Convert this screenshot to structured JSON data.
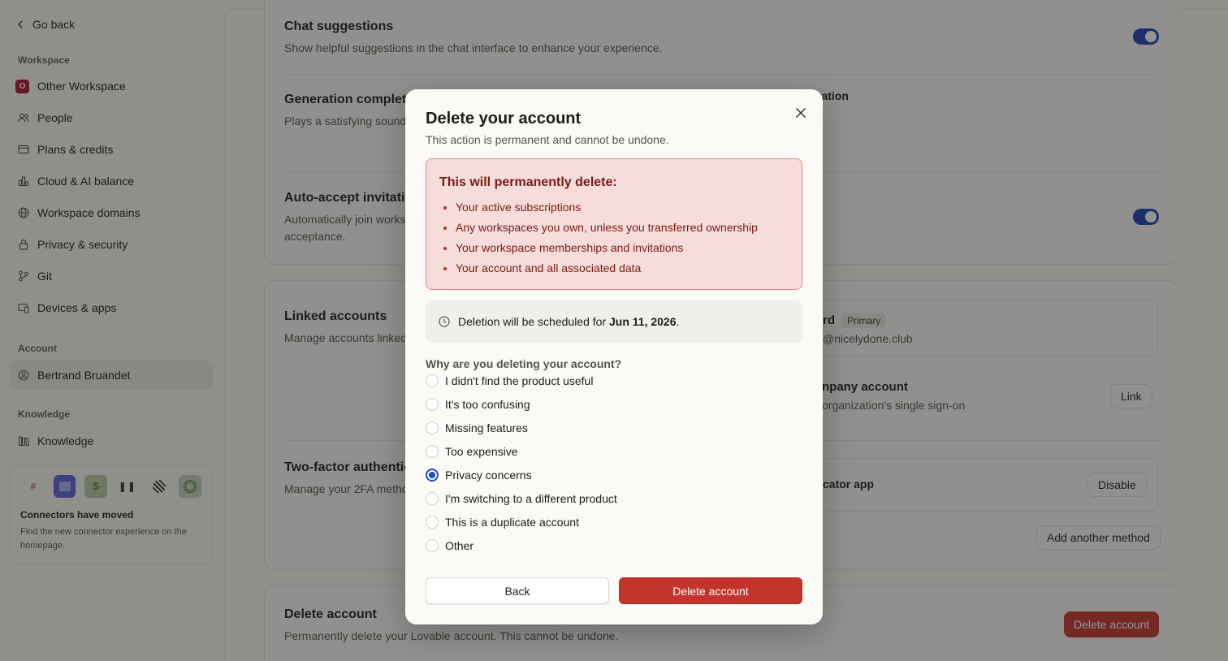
{
  "sidebar": {
    "go_back": "Go back",
    "workspace_label": "Workspace",
    "workspace_badge": "O",
    "items": [
      {
        "label": "Other Workspace",
        "icon": "workspace-badge"
      },
      {
        "label": "People",
        "icon": "people-icon"
      },
      {
        "label": "Plans & credits",
        "icon": "card-icon"
      },
      {
        "label": "Cloud & AI balance",
        "icon": "chart-icon"
      },
      {
        "label": "Workspace domains",
        "icon": "globe-icon"
      },
      {
        "label": "Privacy & security",
        "icon": "lock-icon"
      },
      {
        "label": "Git",
        "icon": "git-icon"
      },
      {
        "label": "Devices & apps",
        "icon": "devices-icon"
      }
    ],
    "account_label": "Account",
    "account_user": "Bertrand Bruandet",
    "knowledge_label": "Knowledge",
    "knowledge_item": "Knowledge",
    "connectors": {
      "title": "Connectors have moved",
      "desc": "Find the new connector experience on the homepage."
    }
  },
  "main": {
    "chat_suggestions": {
      "title": "Chat suggestions",
      "desc": "Show helpful suggestions in the chat interface to enhance your experience."
    },
    "generation_complete": {
      "title": "Generation complete",
      "desc": "Plays a satisfying sound",
      "right_fragment": "ration"
    },
    "auto_accept": {
      "title": "Auto-accept invitatio",
      "desc": "Automatically join works acceptance."
    },
    "linked_accounts": {
      "title": "Linked accounts",
      "desc": "Manage accounts linked",
      "primary_title": "rd",
      "primary_chip": "Primary",
      "primary_email": "@nicelydone.club",
      "company_title": "npany account",
      "company_desc": "organization's single sign-on",
      "link_button": "Link"
    },
    "two_factor": {
      "title": "Two-factor authentic",
      "desc": "Manage your 2FA metho",
      "method_title": "cator app",
      "disable_button": "Disable",
      "add_method_button": "Add another method"
    },
    "delete_account": {
      "title": "Delete account",
      "desc": "Permanently delete your Lovable account. This cannot be undone.",
      "button": "Delete account"
    }
  },
  "modal": {
    "title": "Delete your account",
    "subtitle": "This action is permanent and cannot be undone.",
    "warning_title": "This will permanently delete:",
    "warning_items": [
      "Your active subscriptions",
      "Any workspaces you own, unless you transferred ownership",
      "Your workspace memberships and invitations",
      "Your account and all associated data"
    ],
    "schedule_prefix": "Deletion will be scheduled for ",
    "schedule_date": "Jun 11, 2026",
    "schedule_suffix": ".",
    "reason_label": "Why are you deleting your account?",
    "reasons": [
      "I didn't find the product useful",
      "It's too confusing",
      "Missing features",
      "Too expensive",
      "Privacy concerns",
      "I'm switching to a different product",
      "This is a duplicate account",
      "Other"
    ],
    "selected_reason": "Privacy concerns",
    "back_button": "Back",
    "delete_button": "Delete account"
  },
  "colors": {
    "accent": "#1e3fb7",
    "danger": "#c3342b",
    "warning_bg": "#f6dcda"
  }
}
